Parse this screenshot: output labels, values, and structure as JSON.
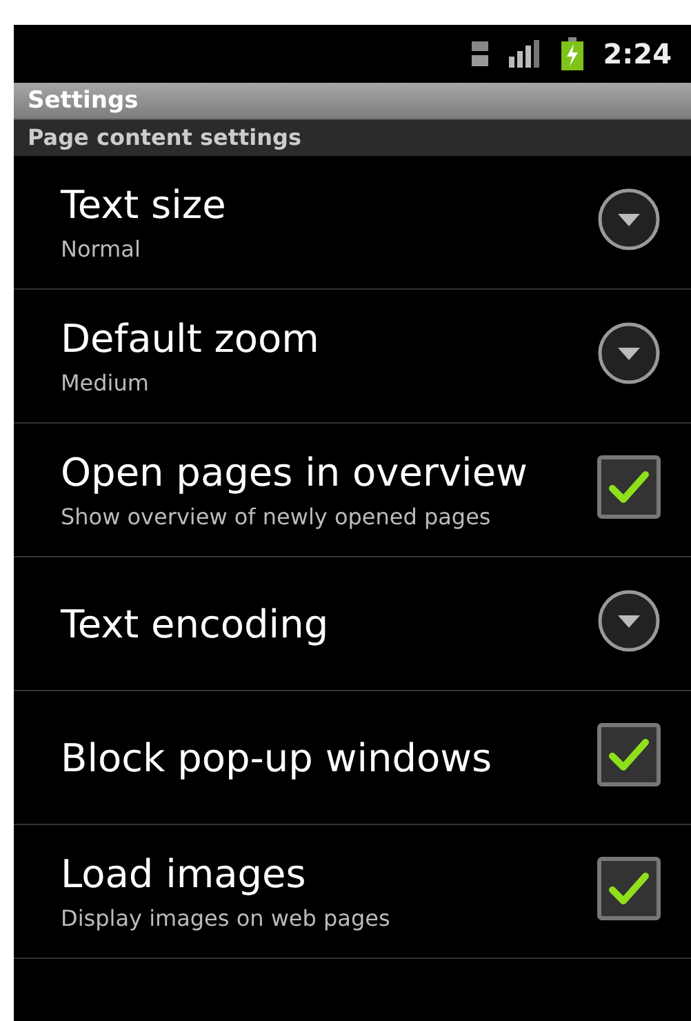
{
  "status_bar": {
    "time": "2:24"
  },
  "title_bar": {
    "title": "Settings"
  },
  "section": {
    "title": "Page content settings"
  },
  "items": [
    {
      "kind": "list",
      "title": "Text size",
      "summary": "Normal"
    },
    {
      "kind": "list",
      "title": "Default zoom",
      "summary": "Medium"
    },
    {
      "kind": "checkbox",
      "title": "Open pages in overview",
      "summary": "Show overview of newly opened pages",
      "checked": true
    },
    {
      "kind": "list",
      "title": "Text encoding"
    },
    {
      "kind": "checkbox",
      "title": "Block pop-up windows",
      "checked": true
    },
    {
      "kind": "checkbox",
      "title": "Load images",
      "summary": "Display images on web pages",
      "checked": true
    }
  ]
}
